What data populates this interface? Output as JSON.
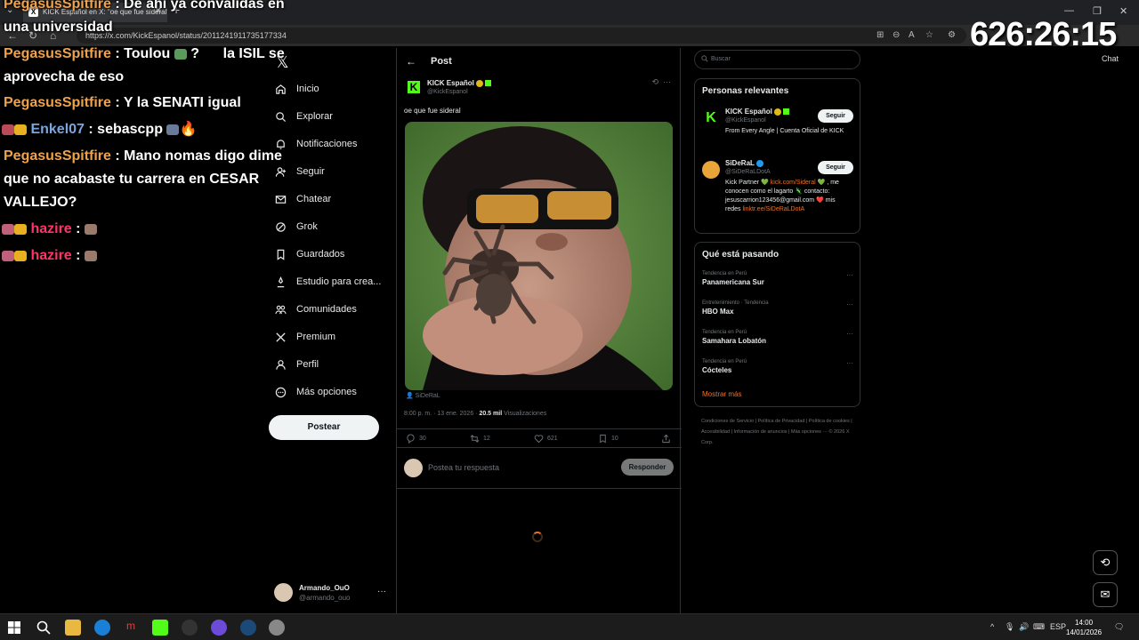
{
  "browser": {
    "tab_title": "KICK Español en X: \"oe que fue sideral\"",
    "url": "https://x.com/KickEspanol/status/2011241911735177334",
    "chat_label": "Chat"
  },
  "timer": "626:26:15",
  "chat_overlay": [
    {
      "user": "PegasusSpitfire",
      "message": ": De ahí ya convalidas en",
      "cont": "una universidad"
    },
    {
      "user": "PegasusSpitfire",
      "message": ": Toulou",
      "extra": "la ISIL se",
      "cont": "aprovecha de eso"
    },
    {
      "user": "PegasusSpitfire",
      "message": ": Y la SENATI igual"
    },
    {
      "user": "Enkel07",
      "message": ": sebascpp"
    },
    {
      "user": "PegasusSpitfire",
      "message": ": Mano nomas digo dime",
      "cont": "que no acabaste tu carrera en CESAR",
      "cont2": "VALLEJO?"
    },
    {
      "user": "hazire",
      "message": ":"
    },
    {
      "user": "hazire",
      "message": ":"
    }
  ],
  "nav": {
    "items": [
      {
        "label": "Inicio",
        "icon": "home-icon"
      },
      {
        "label": "Explorar",
        "icon": "search-icon"
      },
      {
        "label": "Notificaciones",
        "icon": "bell-icon"
      },
      {
        "label": "Seguir",
        "icon": "follow-icon"
      },
      {
        "label": "Chatear",
        "icon": "mail-icon"
      },
      {
        "label": "Grok",
        "icon": "grok-icon"
      },
      {
        "label": "Guardados",
        "icon": "bookmark-icon"
      },
      {
        "label": "Estudio para crea...",
        "icon": "studio-icon"
      },
      {
        "label": "Comunidades",
        "icon": "communities-icon"
      },
      {
        "label": "Premium",
        "icon": "x-icon"
      },
      {
        "label": "Perfil",
        "icon": "profile-icon"
      },
      {
        "label": "Más opciones",
        "icon": "more-icon"
      }
    ],
    "post_button": "Postear",
    "account_name": "Armando_OuO",
    "account_handle": "@armando_ouo"
  },
  "post": {
    "header_title": "Post",
    "author_name": "KICK Español",
    "author_handle": "@KickEspanol",
    "text": "oe que fue sideral",
    "media_credit": "SiDeRaL",
    "time": "8:00 p. m. · 13 ene. 2026 ·",
    "views_count": "20.5 mil",
    "views_label": "Visualizaciones",
    "replies": "30",
    "reposts": "12",
    "likes": "621",
    "bookmarks": "10",
    "reply_placeholder": "Postea tu respuesta",
    "reply_button": "Responder"
  },
  "sidebar": {
    "search_placeholder": "Buscar",
    "relevant_title": "Personas relevantes",
    "people": [
      {
        "name": "KICK Español",
        "handle": "@KickEspanol",
        "bio": "From Every Angle | Cuenta Oficial de KICK",
        "follow": "Seguir"
      },
      {
        "name": "SiDeRaL",
        "handle": "@SiDeRaLDotA",
        "bio_a": "Kick Partner 💚",
        "bio_link1": "kick.com/Sideral",
        "bio_b": "💚 , me conocen como el lagarto 🦎 contacto: jesuscarrion123456@gmail.com ❤️ mis redes",
        "bio_link2": "linktr.ee/SiDeRaLDotA",
        "follow": "Seguir"
      }
    ],
    "trends_title": "Qué está pasando",
    "trends": [
      {
        "context": "Tendencia en Perú",
        "topic": "Panamericana Sur"
      },
      {
        "context": "Entretenimiento · Tendencia",
        "topic": "HBO Max"
      },
      {
        "context": "Tendencia en Perú",
        "topic": "Samahara Lobatón"
      },
      {
        "context": "Tendencia en Perú",
        "topic": "Cócteles"
      }
    ],
    "show_more": "Mostrar más",
    "footer": "Condiciones de Servicio | Política de Privacidad | Política de cookies | Accesibilidad | Información de anuncios | Más opciones ··· © 2026 X Corp."
  },
  "taskbar": {
    "lang": "ESP",
    "time": "14:00",
    "date": "14/01/2026"
  },
  "colors": {
    "accent": "#f26f21",
    "kick_green": "#53fc18",
    "background": "#000000",
    "border": "#2f3336"
  }
}
